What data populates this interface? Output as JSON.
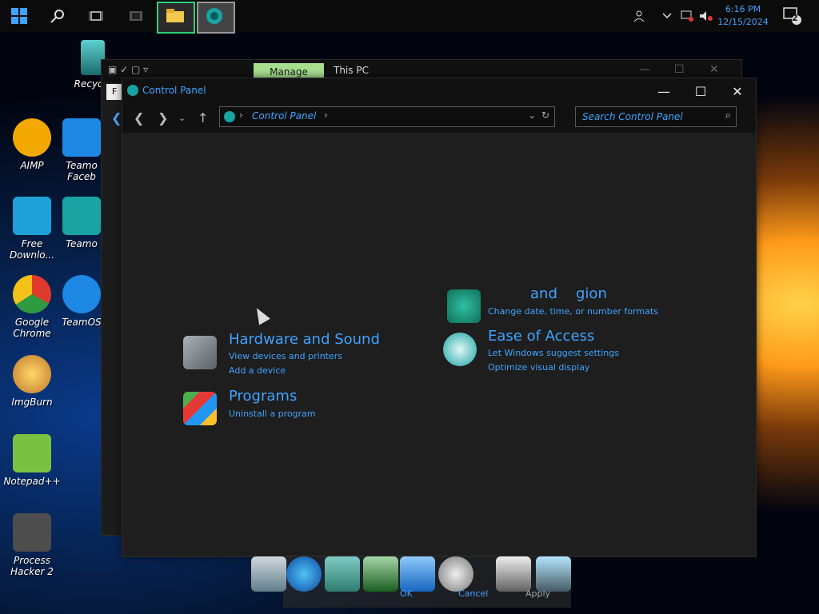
{
  "taskbar": {
    "clock_time": "6:16 PM",
    "clock_date": "12/15/2024",
    "notification_count": "2",
    "pinned": [
      "start-icon",
      "search-icon",
      "task-view-icon",
      "app-icon",
      "file-explorer-icon",
      "control-panel-icon"
    ]
  },
  "desktop": {
    "icons": [
      {
        "label": "Recycle",
        "color": "#3aa0a0"
      },
      {
        "label": "AIMP",
        "color": "#f2a800"
      },
      {
        "label": "Teamo Faceb",
        "color": "#1e88e5"
      },
      {
        "label": "Free Downlo...",
        "color": "#1ea0d8"
      },
      {
        "label": "Teamo",
        "color": "#1aa3a3"
      },
      {
        "label": "Google Chrome",
        "color": "#de3a2b"
      },
      {
        "label": "TeamOS",
        "color": "#1e88e5"
      },
      {
        "label": "ImgBurn",
        "color": "#d4a74a"
      },
      {
        "label": "Notepad++",
        "color": "#7ac142"
      },
      {
        "label": "Process Hacker 2",
        "color": "#6e6e6e"
      }
    ]
  },
  "back_window": {
    "manage_tab": "Manage",
    "title": "This PC",
    "partial_text": "F"
  },
  "window": {
    "title": "Control Panel",
    "address_crumb": "Control Panel",
    "search_placeholder": "Search Control Panel"
  },
  "categories": {
    "hardware": {
      "title": "Hardware and Sound",
      "links": [
        "View devices and printers",
        "Add a device"
      ]
    },
    "programs": {
      "title": "Programs",
      "links": [
        "Uninstall a program"
      ]
    },
    "clock": {
      "title": "and",
      "title_suffix": "gion",
      "links": [
        "Change date, time, or number formats"
      ]
    },
    "ease": {
      "title": "Ease of Access",
      "links": [
        "Let Windows suggest settings",
        "Optimize visual display"
      ]
    }
  },
  "dock": {
    "labels": [
      "OK",
      "Cancel",
      "Apply"
    ]
  },
  "colors": {
    "accent": "#3fa3ff",
    "manage_bg": "#a6e08f",
    "window_bg": "#1e1e1e"
  }
}
